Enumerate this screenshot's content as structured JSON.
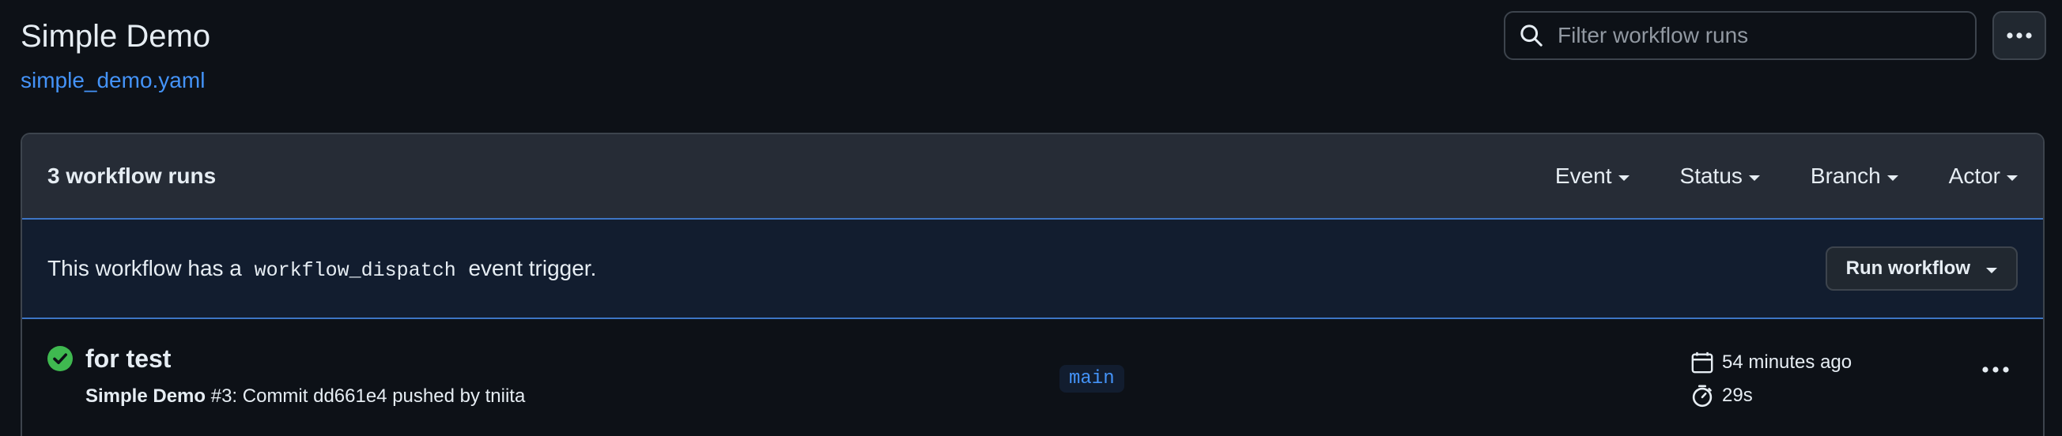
{
  "header": {
    "title": "Simple Demo",
    "file_link": "simple_demo.yaml"
  },
  "search": {
    "placeholder": "Filter workflow runs"
  },
  "runs_box": {
    "count_label": "3 workflow runs",
    "filters": [
      "Event",
      "Status",
      "Branch",
      "Actor"
    ]
  },
  "dispatch": {
    "text_before": "This workflow has a",
    "code": "workflow_dispatch",
    "text_after": "event trigger.",
    "button_label": "Run workflow"
  },
  "runs": [
    {
      "status": "success",
      "title": "for test",
      "workflow_name": "Simple Demo",
      "run_number": "#3",
      "description": ": Commit dd661e4 pushed by tniita",
      "branch": "main",
      "time_ago": "54 minutes ago",
      "duration": "29s"
    }
  ],
  "colors": {
    "background": "#0d1117",
    "link": "#4493f8",
    "success": "#3fb950",
    "header_bg": "#262c36",
    "dispatch_bg": "#121d2f"
  },
  "icons": {
    "search": "search-icon",
    "more": "kebab-horizontal-icon",
    "status": "check-circle-fill-icon",
    "calendar": "calendar-icon",
    "stopwatch": "stopwatch-icon"
  }
}
